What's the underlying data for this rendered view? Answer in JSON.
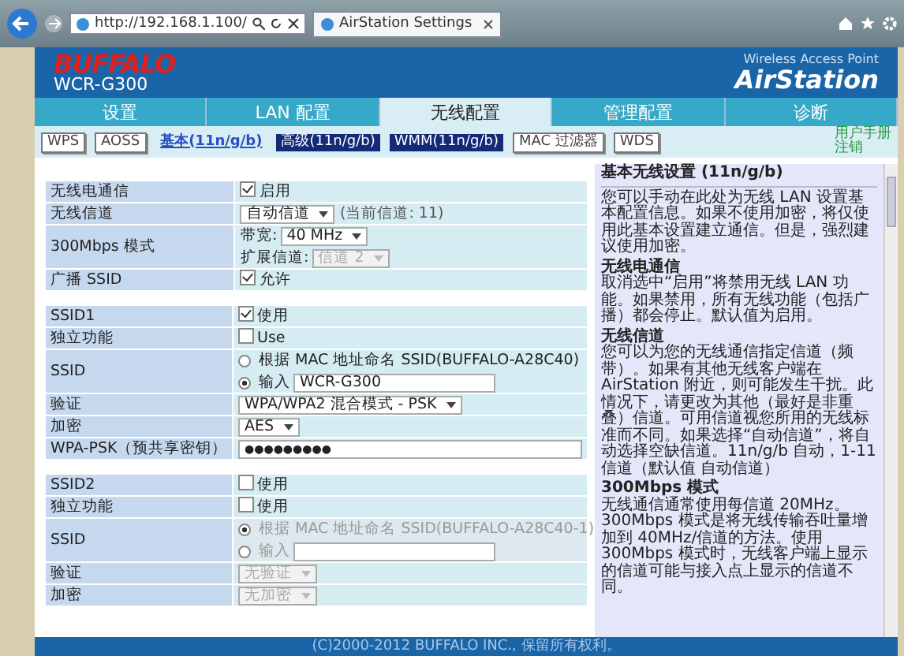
{
  "browser": {
    "address": "http://192.168.1.100/",
    "tab_title": "AirStation Settings"
  },
  "header": {
    "brand": "BUFFALO",
    "model": "WCR-G300",
    "tagline": "Wireless Access Point",
    "product": "AirStation"
  },
  "nav": [
    {
      "label": "设置",
      "selected": false
    },
    {
      "label": "LAN 配置",
      "selected": false
    },
    {
      "label": "无线配置",
      "selected": true
    },
    {
      "label": "管理配置",
      "selected": false
    },
    {
      "label": "诊断",
      "selected": false
    }
  ],
  "subnav": [
    {
      "label": "WPS",
      "kind": "button",
      "selected": false
    },
    {
      "label": "AOSS",
      "kind": "button",
      "selected": false
    },
    {
      "label": "基本(11n/g/b)",
      "kind": "link",
      "selected": true
    },
    {
      "label": "高级(11n/g/b)",
      "kind": "highlight",
      "selected": false
    },
    {
      "label": "WMM(11n/g/b)",
      "kind": "highlight",
      "selected": false
    },
    {
      "label": "MAC 过滤器",
      "kind": "button",
      "selected": false
    },
    {
      "label": "WDS",
      "kind": "button",
      "selected": false
    }
  ],
  "user_links": [
    "用户手册",
    "注销"
  ],
  "radio_settings": [
    {
      "label": "无线电通信",
      "kind": "checkbox",
      "checked": true,
      "text": "启用"
    },
    {
      "label": "无线信道",
      "kind": "select",
      "value": "自动信道",
      "note": "(当前信道: 11)",
      "disabled": false
    },
    {
      "label": "300Mbps 模式",
      "kind": "select-group",
      "fields": [
        {
          "label": "带宽:",
          "value": "40 MHz",
          "disabled": false
        },
        {
          "label": "扩展信道:",
          "value": "信道 2",
          "disabled": true
        }
      ]
    },
    {
      "label": "广播 SSID",
      "kind": "checkbox",
      "checked": true,
      "text": "允许"
    }
  ],
  "ssids": [
    {
      "rows": [
        {
          "label": "SSID1",
          "kind": "checkbox",
          "checked": true,
          "text": "使用"
        },
        {
          "label": "独立功能",
          "kind": "checkbox",
          "checked": false,
          "text": "Use"
        },
        {
          "label": "SSID",
          "kind": "radio-group",
          "disabled": false,
          "options": [
            {
              "text": "根据 MAC 地址命名 SSID(BUFFALO-A28C40)",
              "selected": false
            },
            {
              "text": "输入",
              "selected": true,
              "input": true,
              "value": "WCR-G300"
            }
          ]
        },
        {
          "label": "验证",
          "kind": "select",
          "value": "WPA/WPA2 混合模式 - PSK",
          "disabled": false
        },
        {
          "label": "加密",
          "kind": "select",
          "value": "AES",
          "disabled": false
        },
        {
          "label": "WPA-PSK（预共享密钥）",
          "kind": "password",
          "value": "●●●●●●●●●"
        }
      ]
    },
    {
      "rows": [
        {
          "label": "SSID2",
          "kind": "checkbox",
          "checked": false,
          "text": "使用"
        },
        {
          "label": "独立功能",
          "kind": "checkbox",
          "checked": false,
          "text": "使用"
        },
        {
          "label": "SSID",
          "kind": "radio-group",
          "disabled": true,
          "options": [
            {
              "text": "根据 MAC 地址命名 SSID(BUFFALO-A28C40-1)",
              "selected": true
            },
            {
              "text": "输入",
              "selected": false,
              "input": true
            }
          ]
        },
        {
          "label": "验证",
          "kind": "select",
          "value": "无验证",
          "disabled": true
        },
        {
          "label": "加密",
          "kind": "select",
          "value": "无加密",
          "disabled": true
        }
      ]
    }
  ],
  "help": {
    "title": "基本无线设置 (11n/g/b)",
    "sections": [
      {
        "text": "您可以手动在此处为无线 LAN 设置基本配置信息。如果不使用加密，将仅使用此基本设置建立通信。但是，强烈建议使用加密。"
      },
      {
        "heading": "无线电通信",
        "text": "取消选中“启用”将禁用无线 LAN 功能。如果禁用，所有无线功能（包括广播）都会停止。默认值为启用。"
      },
      {
        "heading": "无线信道",
        "text": "您可以为您的无线通信指定信道（频带）。如果有其他无线客户端在 AirStation 附近，则可能发生干扰。此情况下，请更改为其他（最好是非重叠）信道。可用信道视您所用的无线标准而不同。如果选择“自动信道”，将自动选择空缺信道。11n/g/b 自动，1-11 信道（默认值 自动信道）"
      },
      {
        "heading": "300Mbps 模式",
        "text": "无线通信通常使用每信道 20MHz。300Mbps 模式是将无线传输吞吐量增加到 40MHz/信道的方法。使用 300Mbps 模式时，无线客户端上显示的信道可能与接入点上显示的信道不同。"
      }
    ]
  },
  "footer": "(C)2000-2012 BUFFALO INC., 保留所有权利。"
}
